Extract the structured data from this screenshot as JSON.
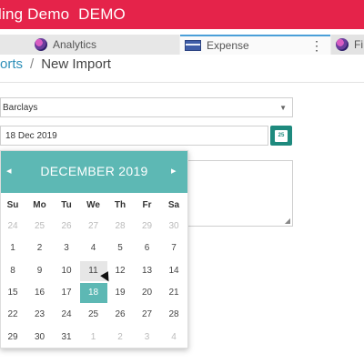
{
  "app": {
    "title": "ling Demo  DEMO",
    "accent": "#e5234a"
  },
  "tabs": [
    {
      "label": "Analytics",
      "icon": "globe-icon"
    },
    {
      "label": "Expense",
      "icon": "card-icon"
    },
    {
      "label": "Fi",
      "icon": "globe-icon"
    }
  ],
  "tab_menu": "⋮",
  "breadcrumb": {
    "parent": "orts",
    "separator": "/",
    "current": "New Import"
  },
  "form": {
    "bank_account": "Barclays",
    "date": "18 Dec 2019",
    "calendar_button_day": "25"
  },
  "picker": {
    "month_label": "DECEMBER 2019",
    "prev": "◂",
    "next": "▸",
    "weekdays": [
      "Su",
      "Mo",
      "Tu",
      "We",
      "Th",
      "Fr",
      "Sa"
    ],
    "weeks": [
      [
        "24",
        "25",
        "26",
        "27",
        "28",
        "29",
        "30"
      ],
      [
        "1",
        "2",
        "3",
        "4",
        "5",
        "6",
        "7"
      ],
      [
        "8",
        "9",
        "10",
        "11",
        "12",
        "13",
        "14"
      ],
      [
        "15",
        "16",
        "17",
        "18",
        "19",
        "20",
        "21"
      ],
      [
        "22",
        "23",
        "24",
        "25",
        "26",
        "27",
        "28"
      ],
      [
        "29",
        "30",
        "31",
        "1",
        "2",
        "3",
        "4"
      ]
    ],
    "muted": [
      [
        0,
        0
      ],
      [
        0,
        1
      ],
      [
        0,
        2
      ],
      [
        0,
        3
      ],
      [
        0,
        4
      ],
      [
        0,
        5
      ],
      [
        0,
        6
      ],
      [
        5,
        3
      ],
      [
        5,
        4
      ],
      [
        5,
        5
      ],
      [
        5,
        6
      ]
    ],
    "hover": [
      2,
      3
    ],
    "selected": [
      3,
      3
    ],
    "accent": "#5db8b4"
  }
}
